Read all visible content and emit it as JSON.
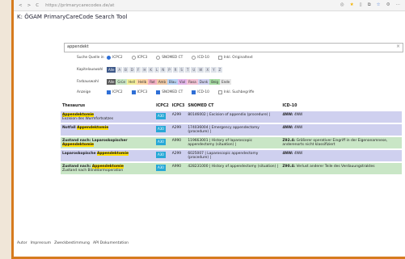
{
  "browser": {
    "url": "https://primarycarecodes.de/at",
    "back": "<",
    "forward": ">",
    "reload": "C"
  },
  "app": {
    "title": "ÖGAM PrimaryCareCode Suchtool",
    "title_prefix": "K: ",
    "title_main": "ÖGAM PrimaryCareCode Search Tool"
  },
  "search": {
    "value": "appendekt",
    "clear": "×"
  },
  "filters": {
    "source": {
      "label": "Suche Quelle in",
      "options": [
        {
          "label": "ICPC2",
          "checked": true
        },
        {
          "label": "ICPC3",
          "checked": false
        },
        {
          "label": "SNOMED CT",
          "checked": false
        },
        {
          "label": "ICD-10",
          "checked": false
        },
        {
          "label": "Inkl. Originaltext",
          "checked": false
        }
      ]
    },
    "chapter": {
      "label": "Kapitelauswahl",
      "items": [
        "Alle",
        "A",
        "B",
        "D",
        "F",
        "H",
        "K",
        "L",
        "N",
        "P",
        "R",
        "S",
        "T",
        "U",
        "W",
        "X",
        "Y",
        "Z"
      ],
      "selected": "Alle"
    },
    "color": {
      "label": "Farbauswahl",
      "items": [
        {
          "label": "Alle",
          "color": "#5b5b5b",
          "text": "#ffffff"
        },
        {
          "label": "Grün",
          "color": "#c9e6c6",
          "text": "#333333"
        },
        {
          "label": "Hell",
          "color": "#f3ef9a",
          "text": "#333333"
        },
        {
          "label": "Hellb",
          "color": "#fdd6a6",
          "text": "#333333"
        },
        {
          "label": "Rot",
          "color": "#f4b1c5",
          "text": "#333333"
        },
        {
          "label": "Amb",
          "color": "#f0c9a5",
          "text": "#333333"
        },
        {
          "label": "Blau",
          "color": "#b9d3f4",
          "text": "#333333"
        },
        {
          "label": "Viol",
          "color": "#e3b6ea",
          "text": "#333333"
        },
        {
          "label": "Rosa",
          "color": "#f3c2d4",
          "text": "#333333"
        },
        {
          "label": "Dunk",
          "color": "#cfd0ef",
          "text": "#333333"
        },
        {
          "label": "Beig",
          "color": "#a8dca4",
          "text": "#333333"
        },
        {
          "label": "Ende",
          "color": "#e6e6e6",
          "text": "#333333"
        }
      ]
    },
    "display": {
      "label": "Anzeige",
      "options": [
        {
          "label": "ICPC2",
          "checked": true
        },
        {
          "label": "ICPC3",
          "checked": true
        },
        {
          "label": "SNOMED CT",
          "checked": true
        },
        {
          "label": "ICD-10",
          "checked": true
        },
        {
          "label": "Inkl. Suchbegriffe",
          "checked": false
        }
      ]
    }
  },
  "table": {
    "headers": [
      "Thesaurus",
      "ICPC2",
      "ICPC3",
      "SNOMED CT",
      "ICD-10"
    ],
    "rows": [
      {
        "style": "blue",
        "title_pre": "",
        "title_hl": "Appendektomie",
        "title_post": "",
        "subtitle": "Exzision des Wurmfortsatzes",
        "icpc2": "A30",
        "icpc3": "A299",
        "snomed": "80146002 | Excision of appendix (procedure) |",
        "icd_code": "4NW:",
        "icd_text": "4NW"
      },
      {
        "style": "blue",
        "title_pre": "Notfall ",
        "title_hl": "Appendektomie",
        "title_post": "",
        "subtitle": "",
        "icpc2": "A30",
        "icpc3": "A299",
        "snomed": "174036004 | Emergency appendectomy (procedure) |",
        "icd_code": "4NW:",
        "icd_text": "4NW"
      },
      {
        "style": "green",
        "title_pre": "Zustand nach: Laparoskopischer ",
        "title_hl": "Appendektomie",
        "title_post": "",
        "subtitle": "",
        "icpc2": "A30",
        "icpc3": "A990",
        "snomed": "119663001 | History of laparoscopic appendectomy (situation) |",
        "icd_code": "Z92.4:",
        "icd_text": "Größerer operativer Eingriff in der Eigenanamnese, anderenorts nicht klassifiziert"
      },
      {
        "style": "blue",
        "title_pre": "Laparoskopische ",
        "title_hl": "Appendektomie",
        "title_post": "",
        "subtitle": "",
        "icpc2": "A30",
        "icpc3": "A299",
        "snomed": "6025007 | Laparoscopic appendectomy (procedure) |",
        "icd_code": "4NW:",
        "icd_text": "4NW"
      },
      {
        "style": "green",
        "title_pre": "Zustand nach: ",
        "title_hl": "Appendektomie",
        "title_post": "",
        "subtitle": "Zustand nach Blinddarmoperation",
        "icpc2": "A30",
        "icpc3": "A990",
        "snomed": "428231000 | History of appendectomy (situation) |",
        "icd_code": "Z90.4:",
        "icd_text": "Verlust anderer Teile des Verdauungstraktes"
      }
    ]
  },
  "footer": {
    "links": [
      "Autor",
      "Impressum",
      "Zweckbestimmung",
      "API Dokumentation"
    ]
  }
}
